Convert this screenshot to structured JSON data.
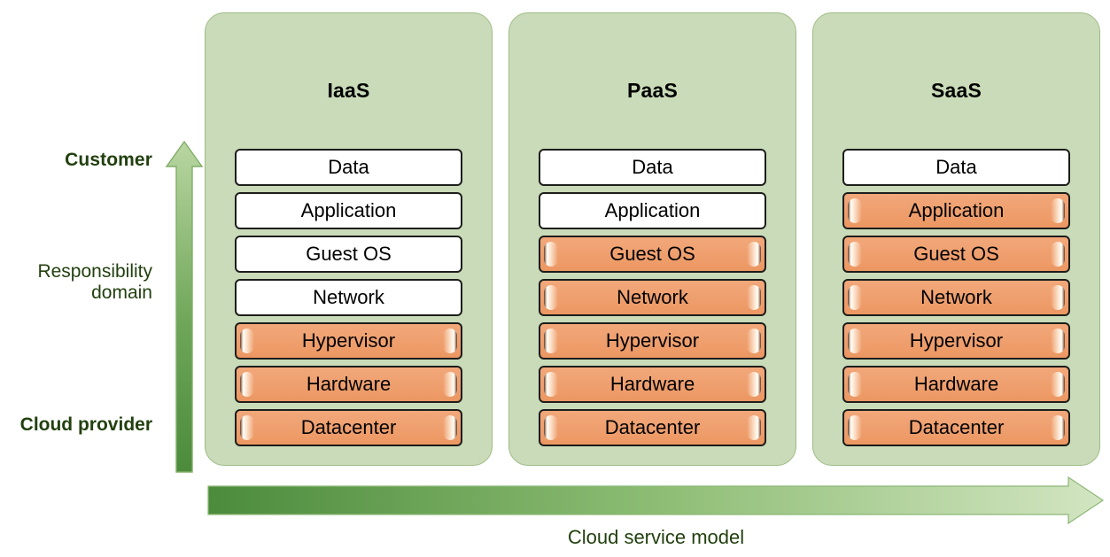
{
  "axis": {
    "vertical": {
      "top_label": "Customer",
      "middle_label": "Responsibility domain",
      "bottom_label": "Cloud provider",
      "arrow_icon": "up-arrow-icon",
      "gradient_from": "#4c8b3c",
      "gradient_to": "#b9d6a2"
    },
    "horizontal": {
      "label": "Cloud service model",
      "arrow_icon": "right-arrow-icon",
      "gradient_from": "#4c8b3c",
      "gradient_to": "#cfe3bd"
    }
  },
  "colors": {
    "panel_fill": "#c9dbb8",
    "panel_border": "#9fbc87",
    "customer_layer_fill": "#ffffff",
    "provider_layer_fill": "#ef9f6e",
    "layer_border": "#1d1d1b",
    "label_text": "#22400f"
  },
  "legend": {
    "customer_owned": "white",
    "provider_owned": "orange"
  },
  "columns": [
    {
      "title": "IaaS",
      "layers": [
        {
          "label": "Data",
          "owner": "customer"
        },
        {
          "label": "Application",
          "owner": "customer"
        },
        {
          "label": "Guest OS",
          "owner": "customer"
        },
        {
          "label": "Network",
          "owner": "customer"
        },
        {
          "label": "Hypervisor",
          "owner": "provider"
        },
        {
          "label": "Hardware",
          "owner": "provider"
        },
        {
          "label": "Datacenter",
          "owner": "provider"
        }
      ]
    },
    {
      "title": "PaaS",
      "layers": [
        {
          "label": "Data",
          "owner": "customer"
        },
        {
          "label": "Application",
          "owner": "customer"
        },
        {
          "label": "Guest OS",
          "owner": "provider"
        },
        {
          "label": "Network",
          "owner": "provider"
        },
        {
          "label": "Hypervisor",
          "owner": "provider"
        },
        {
          "label": "Hardware",
          "owner": "provider"
        },
        {
          "label": "Datacenter",
          "owner": "provider"
        }
      ]
    },
    {
      "title": "SaaS",
      "layers": [
        {
          "label": "Data",
          "owner": "customer"
        },
        {
          "label": "Application",
          "owner": "provider"
        },
        {
          "label": "Guest OS",
          "owner": "provider"
        },
        {
          "label": "Network",
          "owner": "provider"
        },
        {
          "label": "Hypervisor",
          "owner": "provider"
        },
        {
          "label": "Hardware",
          "owner": "provider"
        },
        {
          "label": "Datacenter",
          "owner": "provider"
        }
      ]
    }
  ]
}
